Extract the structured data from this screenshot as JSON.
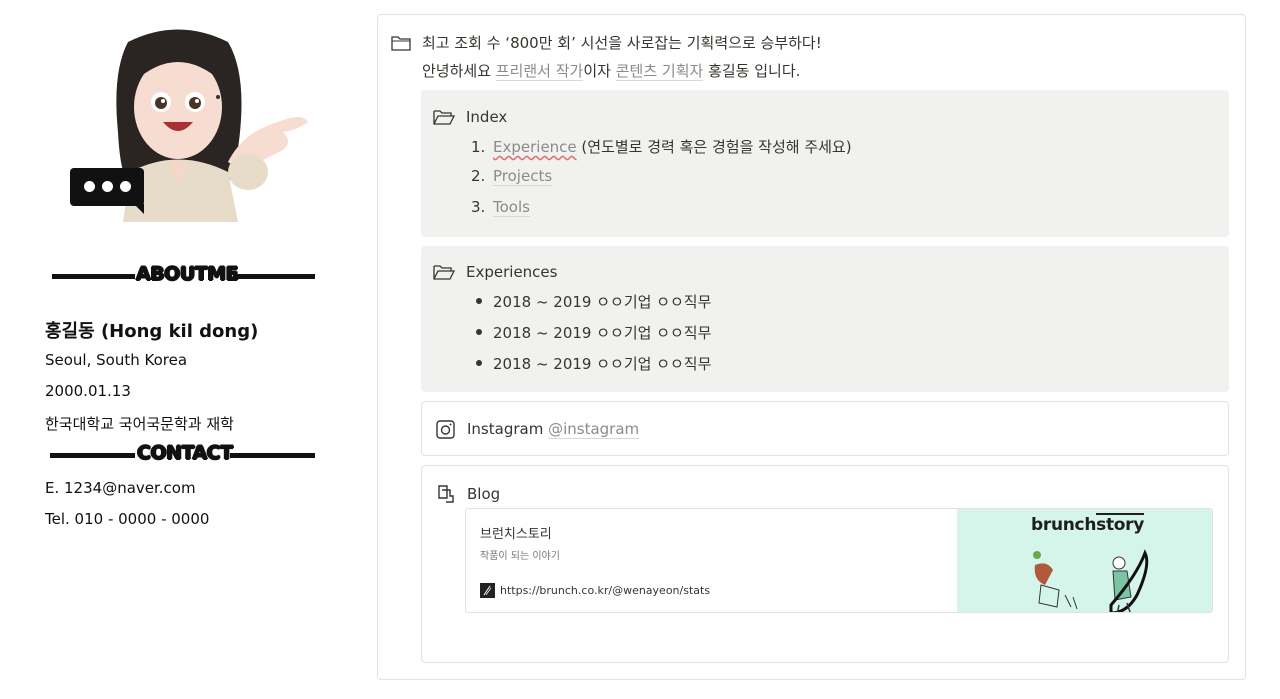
{
  "profile": {
    "about_heading": "ABOUTME",
    "name": "홍길동 (Hong kil dong)",
    "location": "Seoul, South Korea",
    "birth": "2000.01.13",
    "school": "한국대학교 국어국문학과 재학",
    "contact_heading": "CONTACT",
    "email": "E. 1234@naver.com",
    "tel": "Tel. 010 - 0000 - 0000"
  },
  "header": {
    "headline": "최고 조회 수 ‘800만 회’ 시선을 사로잡는 기획력으로 승부하다!",
    "intro_1": "안녕하세요 ",
    "intro_link_1": "프리랜서 작가",
    "intro_2": "이자 ",
    "intro_link_2": "콘텐츠 기획자",
    "intro_3": " 홍길동 입니다."
  },
  "index": {
    "title": "Index",
    "items": [
      {
        "num": "1.",
        "label": "Experience",
        "note": " (연도별로 경력 혹은 경험을 작성해 주세요)"
      },
      {
        "num": "2.",
        "label": "Projects"
      },
      {
        "num": "3.",
        "label": "Tools"
      }
    ]
  },
  "experiences": {
    "title": "Experiences",
    "items": [
      "2018 ~ 2019 ㅇㅇ기업 ㅇㅇ직무",
      "2018 ~ 2019 ㅇㅇ기업 ㅇㅇ직무",
      "2018 ~ 2019 ㅇㅇ기업 ㅇㅇ직무"
    ]
  },
  "instagram": {
    "label": "Instagram ",
    "handle": "@instagram"
  },
  "blog": {
    "title": "Blog",
    "bookmark_title": "브런치스토리",
    "bookmark_desc": "작품이 되는 이야기",
    "bookmark_url": "https://brunch.co.kr/@wenayeon/stats",
    "brand_1": "brunch",
    "brand_2": "story"
  },
  "colors": {
    "callout_bg": "#f1f1ef",
    "link": "#8d8b87",
    "bookmark_image_bg": "#d6f5ea"
  }
}
